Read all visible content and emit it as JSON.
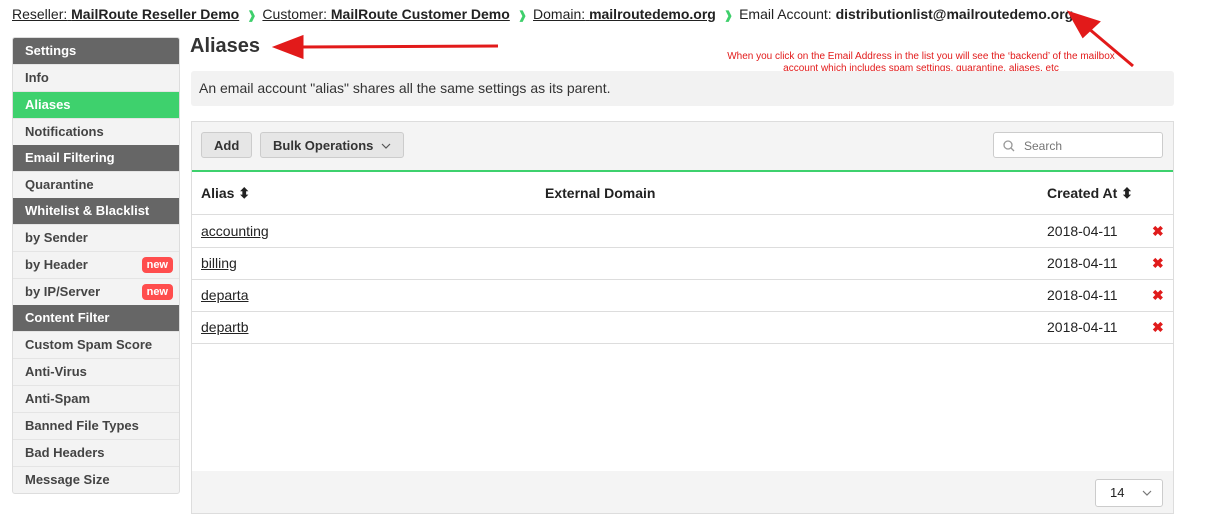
{
  "breadcrumb": {
    "reseller_label": "Reseller:",
    "reseller_value": "MailRoute Reseller Demo",
    "customer_label": "Customer:",
    "customer_value": "MailRoute Customer Demo",
    "domain_label": "Domain:",
    "domain_value": "mailroutedemo.org",
    "account_label": "Email Account:",
    "account_value": "distributionlist@mailroutedemo.org",
    "separator": "❱"
  },
  "sidebar": {
    "settings_header": "Settings",
    "info": "Info",
    "aliases": "Aliases",
    "notifications": "Notifications",
    "email_filtering_header": "Email Filtering",
    "quarantine": "Quarantine",
    "whitelist_header": "Whitelist & Blacklist",
    "by_sender": "by Sender",
    "by_header": "by Header",
    "by_ip": "by IP/Server",
    "new_badge": "new",
    "content_filter_header": "Content Filter",
    "custom_spam_score": "Custom Spam Score",
    "anti_virus": "Anti-Virus",
    "anti_spam": "Anti-Spam",
    "banned_file_types": "Banned File Types",
    "bad_headers": "Bad Headers",
    "message_size": "Message Size"
  },
  "main": {
    "title": "Aliases",
    "description": "An email account \"alias\" shares all the same settings as its parent.",
    "annotation": "When you click on the Email Address in the list you will see the ‘backend’ of the mailbox account which includes spam settings, quarantine, aliases, etc"
  },
  "toolbar": {
    "add_label": "Add",
    "bulk_label": "Bulk Operations",
    "search_placeholder": "Search"
  },
  "table": {
    "col_alias": "Alias",
    "col_external": "External Domain",
    "col_created": "Created At",
    "sort_glyph": "⬍",
    "delete_glyph": "✖",
    "rows": [
      {
        "alias": "accounting",
        "external": "",
        "created": "2018-04-11"
      },
      {
        "alias": "billing",
        "external": "",
        "created": "2018-04-11"
      },
      {
        "alias": "departa",
        "external": "",
        "created": "2018-04-11"
      },
      {
        "alias": "departb",
        "external": "",
        "created": "2018-04-11"
      }
    ]
  },
  "pager": {
    "per_page": "14"
  },
  "colors": {
    "accent_green": "#3ed16d",
    "annotation_red": "#e21a1a",
    "badge_red": "#ff4d4d"
  }
}
